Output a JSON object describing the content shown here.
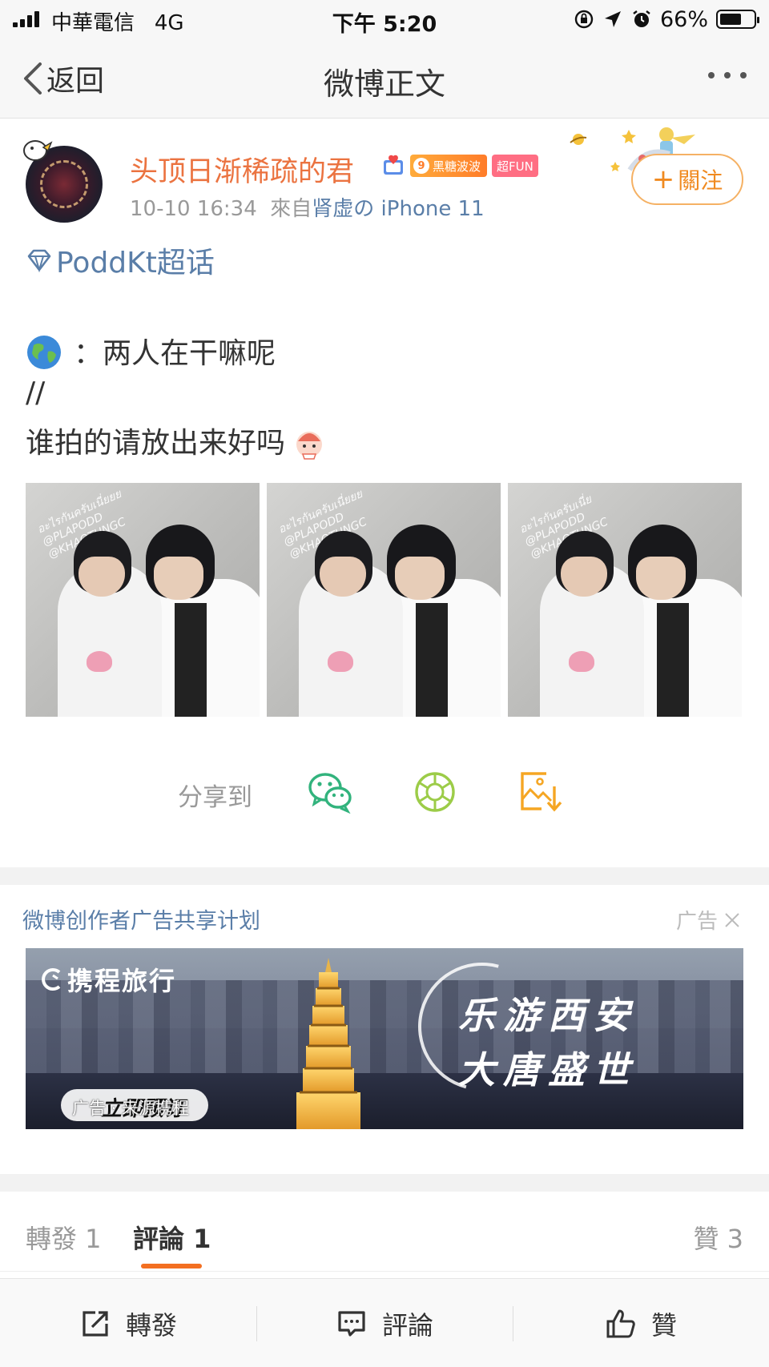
{
  "status_bar": {
    "carrier": "中華電信",
    "network": "4G",
    "time": "下午 5:20",
    "battery": "66%",
    "battery_level": 0.66
  },
  "nav": {
    "back_label": "返回",
    "title": "微博正文"
  },
  "post": {
    "username": "头顶日渐稀疏的君",
    "badge_level": "9",
    "badge_level_label": "黑糖波波",
    "badge_fun": "超FUN",
    "time": "10-10 16:34",
    "source_prefix": "來自",
    "source": "肾虚の iPhone 11",
    "follow_label": "關注",
    "topic": "PoddKt超话",
    "line1": "：两人在干嘛呢",
    "line2": "//",
    "line3": "谁拍的请放出来好吗",
    "photo_watermarks": [
      [
        "อะไรกันครับเนี่ยยย",
        "@PLAPODD",
        "@KHAOTUNGC"
      ],
      [
        "อะไรกันครับเนี่ยยย",
        "@PLAPODD",
        "@KHAOTUNGC"
      ],
      [
        "อะไรกันครับเนี่ย",
        "@PLAPODD",
        "@KHAOTUNGC"
      ]
    ]
  },
  "share": {
    "label": "分享到",
    "targets": [
      "wechat-icon",
      "moments-icon",
      "save-image-icon"
    ]
  },
  "ad": {
    "title": "微博创作者广告共享计划",
    "tag": "广告",
    "brand": "携程旅行",
    "slogan_line1": "乐游西安",
    "slogan_line2": "大唐盛世",
    "cta": "立即预订",
    "overlay_text": "广告 · 来源携程"
  },
  "tabs": {
    "reposts": "轉發 1",
    "comments": "評論 1",
    "likes": "贊 3"
  },
  "toolbar": {
    "repost": "轉發",
    "comment": "評論",
    "like": "贊"
  },
  "colors": {
    "username": "#eb7340",
    "link": "#5a7ea8",
    "accent": "#f36f21",
    "follow_border": "#f5b164"
  }
}
